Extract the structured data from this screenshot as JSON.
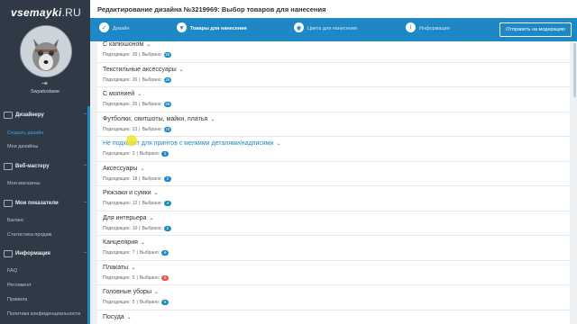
{
  "sidebar": {
    "logo": "vsemayki",
    "logo_suffix": ".RU",
    "username": "Swyatoslawe",
    "sections": [
      {
        "label": "Дизайнеру",
        "items": [
          "Создать дизайн",
          "Мои дизайны"
        ]
      },
      {
        "label": "Веб-мастеру",
        "items": [
          "Мои магазины"
        ]
      },
      {
        "label": "Мои показатели",
        "items": [
          "Баланс",
          "Статистика продаж"
        ]
      },
      {
        "label": "Информация",
        "items": [
          "FAQ",
          "Регламент",
          "Правила",
          "Политика конфиденциальности"
        ]
      }
    ]
  },
  "header": {
    "title": "Редактирование дизайна №3219969: Выбор товаров для нанесения"
  },
  "steps": [
    {
      "label": "Дизайн",
      "icon": "check-icon"
    },
    {
      "label": "Товары для нанесения",
      "icon": "shirt-icon"
    },
    {
      "label": "Цвета для нанесения",
      "icon": "palette-icon"
    },
    {
      "label": "Информация",
      "icon": "info-icon"
    }
  ],
  "moderation_button": "Отправить на модерацию",
  "meta_labels": {
    "fit": "Подходящих:",
    "selected": "Выбрано:"
  },
  "categories": [
    {
      "name": "С капюшоном",
      "fit": "26",
      "selected": "26"
    },
    {
      "name": "Текстильные аксессуары",
      "fit": "26",
      "selected": "26"
    },
    {
      "name": "С молнией",
      "fit": "25",
      "selected": "25"
    },
    {
      "name": "Футболки, свитшоты, майки, платья",
      "fit": "23",
      "selected": "23"
    },
    {
      "name": "Не подходит для принтов с мелкими деталями/надписями",
      "fit": "3",
      "selected": "3"
    },
    {
      "name": "Аксессуары",
      "fit": "18",
      "selected": "2"
    },
    {
      "name": "Рюкзаки и сумки",
      "fit": "12",
      "selected": "4"
    },
    {
      "name": "Для интерьера",
      "fit": "10",
      "selected": "2"
    },
    {
      "name": "Канцелярия",
      "fit": "7",
      "selected": "6"
    },
    {
      "name": "Плакаты",
      "fit": "5",
      "selected": "0"
    },
    {
      "name": "Головные уборы",
      "fit": "5",
      "selected": "5"
    },
    {
      "name": "Посуда",
      "fit": "",
      "selected": ""
    }
  ],
  "colors": {
    "accent": "#1e88c7",
    "sidebar": "#2f3a46",
    "badge_zero": "#e05a4e"
  }
}
